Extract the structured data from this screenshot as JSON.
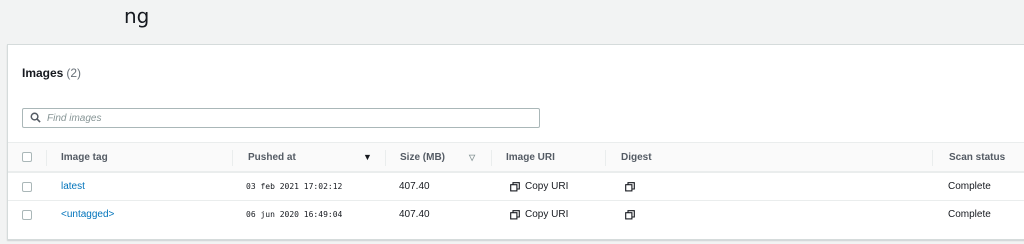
{
  "page": {
    "title_fragment": "ng"
  },
  "images_panel": {
    "title": "Images",
    "count": "(2)",
    "search": {
      "placeholder": "Find images",
      "value": ""
    }
  },
  "table": {
    "columns": {
      "image_tag": "Image tag",
      "pushed_at": "Pushed at",
      "size": "Size (MB)",
      "image_uri": "Image URI",
      "digest": "Digest",
      "scan_status": "Scan status"
    },
    "sort": {
      "column": "Pushed at",
      "direction": "descending"
    },
    "rows": [
      {
        "tag": "latest",
        "pushed_at": "03 feb 2021 17:02:12",
        "size": "407.40",
        "uri_label": "Copy URI",
        "scan_status": "Complete"
      },
      {
        "tag": "<untagged>",
        "pushed_at": "06 jun 2020 16:49:04",
        "size": "407.40",
        "uri_label": "Copy URI",
        "scan_status": "Complete"
      }
    ]
  },
  "icons": {
    "search": "search-icon",
    "copy": "copy-icon",
    "sort_desc": "caret-down-icon",
    "sort_neutral": "sort-caret-icon"
  },
  "colors": {
    "link": "#0073bb",
    "background": "#f2f3f3",
    "panel": "#ffffff"
  }
}
